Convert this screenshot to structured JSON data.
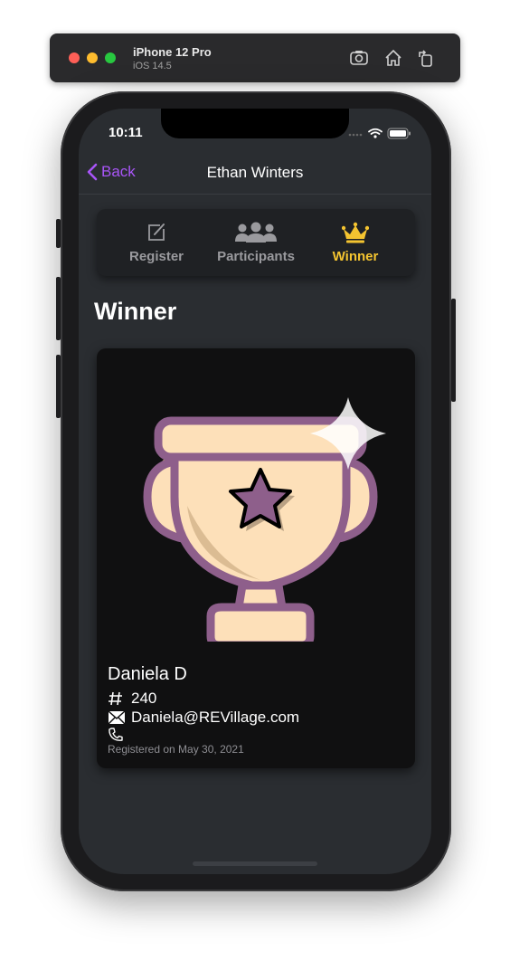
{
  "simulator": {
    "device_name": "iPhone 12 Pro",
    "os_version": "iOS 14.5"
  },
  "status_bar": {
    "time": "10:11"
  },
  "nav": {
    "back_label": "Back",
    "title": "Ethan Winters"
  },
  "segments": [
    {
      "label": "Register",
      "icon": "compose-icon",
      "active": false
    },
    {
      "label": "Participants",
      "icon": "people-icon",
      "active": false
    },
    {
      "label": "Winner",
      "icon": "crown-icon",
      "active": true
    }
  ],
  "section": {
    "title": "Winner"
  },
  "winner": {
    "name": "Daniela D",
    "number": "240",
    "email": "Daniela@REVillage.com",
    "phone": "",
    "registered": "Registered on May 30, 2021"
  },
  "colors": {
    "accent": "#a855f7",
    "active_tab": "#f4c430",
    "trophy_fill": "#fde0b9",
    "trophy_outline": "#8e5f8b"
  }
}
